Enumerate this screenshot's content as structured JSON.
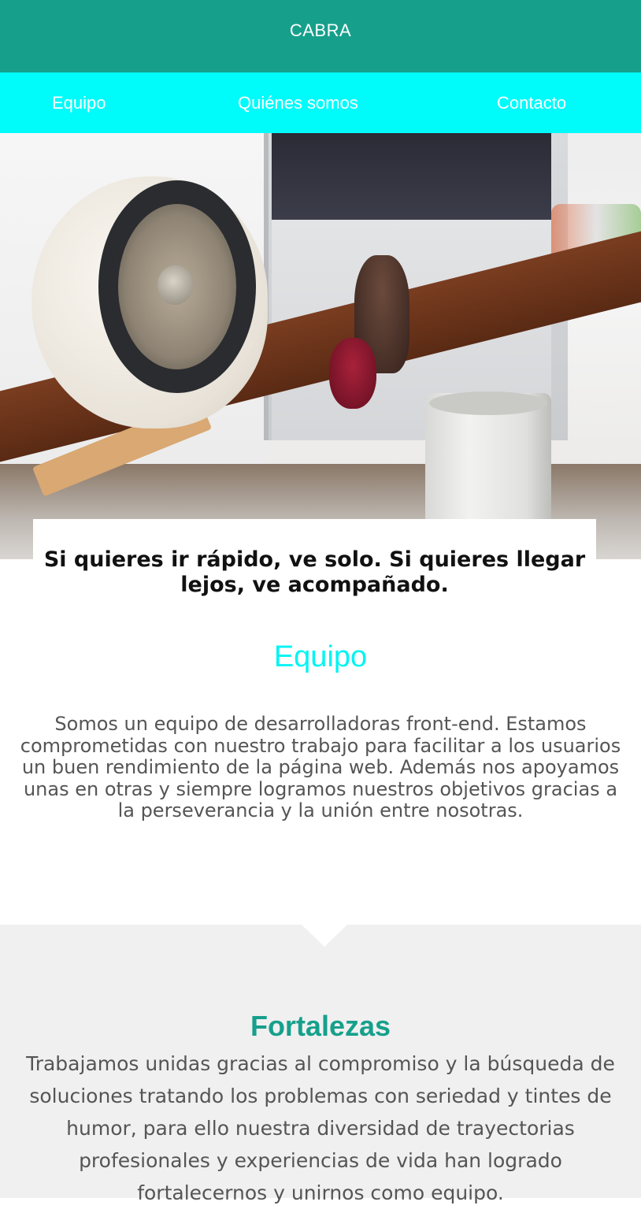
{
  "header": {
    "brand": "CABRA",
    "background_color": "#16a08c"
  },
  "nav": {
    "background_color": "#00fbfb",
    "items": [
      {
        "label": "Equipo"
      },
      {
        "label": "Quiénes somos"
      },
      {
        "label": "Contacto"
      }
    ]
  },
  "hero": {
    "image_icon": "desk-speaker-photo",
    "quote": "Si quieres ir rápido, ve solo. Si quieres llegar lejos, ve acompañado."
  },
  "equipo": {
    "title": "Equipo",
    "title_color": "#00f4f4",
    "text": "Somos un equipo de desarrolladoras front-end. Estamos comprometidas con nuestro trabajo para facilitar a los usuarios un buen rendimiento de la página web. Además nos apoyamos unas en otras y siempre logramos nuestros objetivos gracias a la perseverancia y la unión entre nosotras."
  },
  "fortalezas": {
    "title": "Fortalezas",
    "title_color": "#16a08c",
    "background_color": "#f0f0f0",
    "text": "Trabajamos unidas gracias al compromiso y la búsqueda de soluciones tratando los problemas con seriedad y tintes de humor, para ello nuestra diversidad de trayectorias profesionales y experiencias de vida han logrado fortalecernos y unirnos como equipo."
  }
}
